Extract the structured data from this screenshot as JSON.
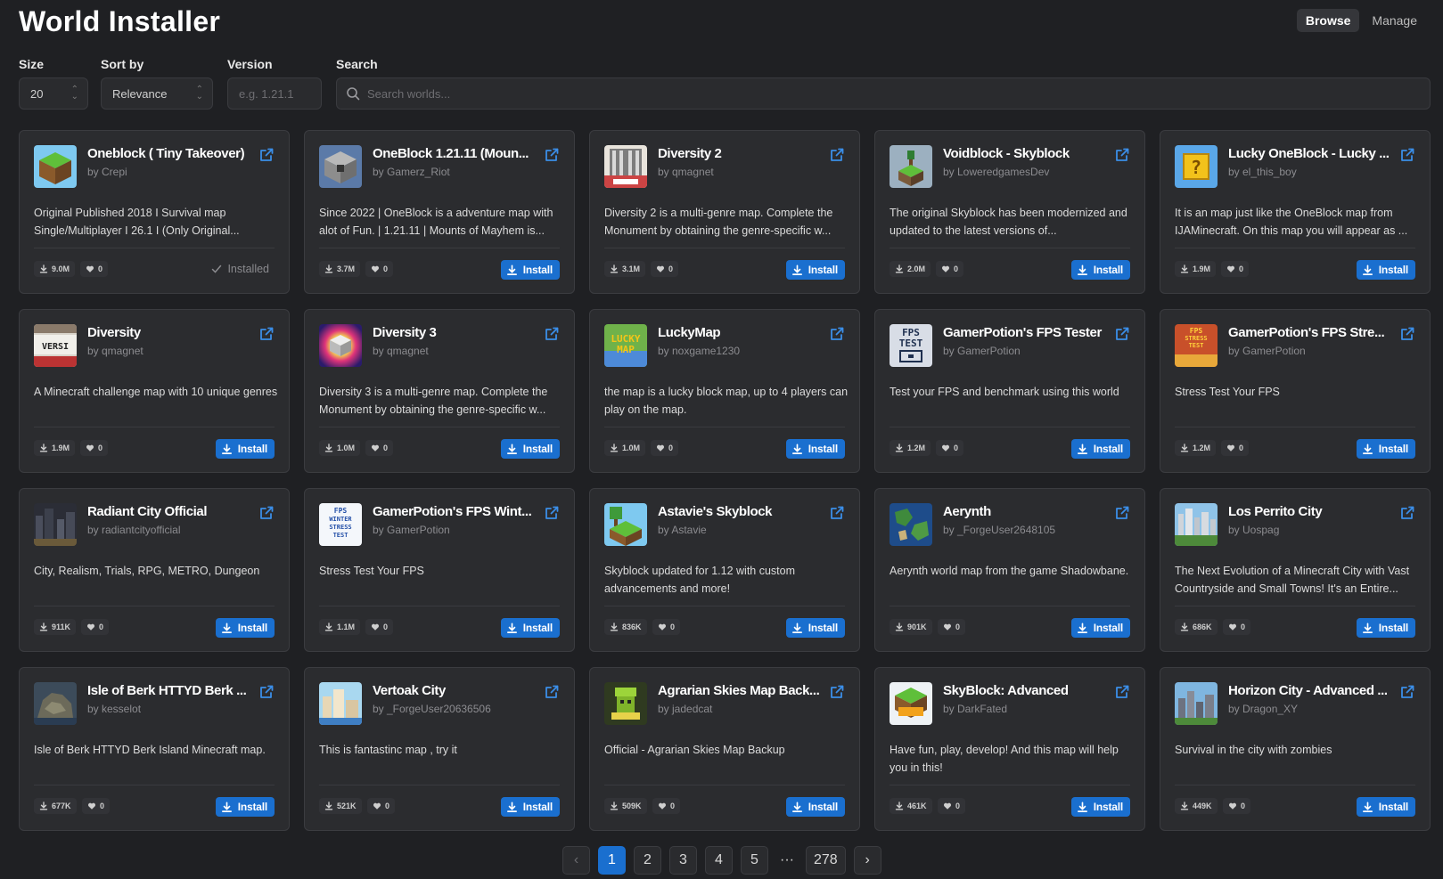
{
  "app": {
    "title": "World Installer"
  },
  "top_tabs": [
    {
      "label": "Browse",
      "active": true
    },
    {
      "label": "Manage",
      "active": false
    }
  ],
  "filters": {
    "size": {
      "label": "Size",
      "value": "20"
    },
    "sort": {
      "label": "Sort by",
      "value": "Relevance"
    },
    "version": {
      "label": "Version",
      "placeholder": "e.g. 1.21.1"
    },
    "search": {
      "label": "Search",
      "placeholder": "Search worlds..."
    }
  },
  "labels": {
    "install": "Install",
    "installed": "Installed"
  },
  "colors": {
    "accent": "#1a6fcf",
    "background": "#1f2023",
    "card": "#2b2c2f"
  },
  "worlds": [
    {
      "title": "Oneblock ( Tiny Takeover)",
      "author": "by Crepi",
      "description": "Original Published 2018 I Survival map Single/Multiplayer I 26.1 I (Only Original...",
      "downloads": "9.0M",
      "likes": "0",
      "installed": true,
      "thumb": "grass"
    },
    {
      "title": "OneBlock 1.21.11 (Moun...",
      "author": "by Gamerz_Riot",
      "description": "Since 2022 | OneBlock is a adventure map with alot of Fun. | 1.21.11 | Mounts of Mayhem is...",
      "downloads": "3.7M",
      "likes": "0",
      "installed": false,
      "thumb": "stone"
    },
    {
      "title": "Diversity 2",
      "author": "by qmagnet",
      "description": "Diversity 2 is a multi-genre map. Complete the Monument by obtaining the genre-specific w...",
      "downloads": "3.1M",
      "likes": "0",
      "installed": false,
      "thumb": "pillar"
    },
    {
      "title": "Voidblock - Skyblock",
      "author": "by LoweredgamesDev",
      "description": "The original Skyblock has been modernized and updated to the latest versions of...",
      "downloads": "2.0M",
      "likes": "0",
      "installed": false,
      "thumb": "void"
    },
    {
      "title": "Lucky OneBlock - Lucky ...",
      "author": "by el_this_boy",
      "description": "It is an map just like the OneBlock map from IJAMinecraft. On this map you will appear as ...",
      "downloads": "1.9M",
      "likes": "0",
      "installed": false,
      "thumb": "lucky"
    },
    {
      "title": "Diversity",
      "author": "by qmagnet",
      "description": "A Minecraft challenge map with 10 unique genres",
      "downloads": "1.9M",
      "likes": "0",
      "installed": false,
      "thumb": "diversity"
    },
    {
      "title": "Diversity 3",
      "author": "by qmagnet",
      "description": "Diversity 3 is a multi-genre map. Complete the Monument by obtaining the genre-specific w...",
      "downloads": "1.0M",
      "likes": "0",
      "installed": false,
      "thumb": "rainbow"
    },
    {
      "title": "LuckyMap",
      "author": "by noxgame1230",
      "description": "the map is a lucky block map, up to 4 players can play on the map.",
      "downloads": "1.0M",
      "likes": "0",
      "installed": false,
      "thumb": "luckymap"
    },
    {
      "title": "GamerPotion's FPS Tester",
      "author": "by GamerPotion",
      "description": "Test your FPS and benchmark using this world",
      "downloads": "1.2M",
      "likes": "0",
      "installed": false,
      "thumb": "fps"
    },
    {
      "title": "GamerPotion's FPS Stre...",
      "author": "by GamerPotion",
      "description": "Stress Test Your FPS",
      "downloads": "1.2M",
      "likes": "0",
      "installed": false,
      "thumb": "fpsstress"
    },
    {
      "title": "Radiant City Official",
      "author": "by radiantcityofficial",
      "description": "City, Realism, Trials, RPG, METRO, Dungeon",
      "downloads": "911K",
      "likes": "0",
      "installed": false,
      "thumb": "city"
    },
    {
      "title": "GamerPotion's FPS Wint...",
      "author": "by GamerPotion",
      "description": "Stress Test Your FPS",
      "downloads": "1.1M",
      "likes": "0",
      "installed": false,
      "thumb": "winter"
    },
    {
      "title": "Astavie's Skyblock",
      "author": "by Astavie",
      "description": "Skyblock updated for 1.12 with custom advancements and more!",
      "downloads": "836K",
      "likes": "0",
      "installed": false,
      "thumb": "skyblock"
    },
    {
      "title": "Aerynth",
      "author": "by _ForgeUser2648105",
      "description": "Aerynth world map from the game Shadowbane.",
      "downloads": "901K",
      "likes": "0",
      "installed": false,
      "thumb": "map"
    },
    {
      "title": "Los Perrito City",
      "author": "by Uospag",
      "description": "The Next Evolution of a Minecraft City with Vast Countryside and Small Towns! It's an Entire...",
      "downloads": "686K",
      "likes": "0",
      "installed": false,
      "thumb": "perrito"
    },
    {
      "title": "Isle of Berk HTTYD Berk ...",
      "author": "by kesselot",
      "description": "Isle of Berk HTTYD Berk Island Minecraft map.",
      "downloads": "677K",
      "likes": "0",
      "installed": false,
      "thumb": "berk"
    },
    {
      "title": "Vertoak City",
      "author": "by _ForgeUser20636506",
      "description": "This is fantastinc map , try it",
      "downloads": "521K",
      "likes": "0",
      "installed": false,
      "thumb": "vertoak"
    },
    {
      "title": "Agrarian Skies Map Back...",
      "author": "by jadedcat",
      "description": "Official - Agrarian Skies Map Backup",
      "downloads": "509K",
      "likes": "0",
      "installed": false,
      "thumb": "agrarian"
    },
    {
      "title": "SkyBlock: Advanced",
      "author": "by DarkFated",
      "description": "Have fun, play, develop! And this map will help you in this!",
      "downloads": "461K",
      "likes": "0",
      "installed": false,
      "thumb": "advanced"
    },
    {
      "title": "Horizon City - Advanced ...",
      "author": "by Dragon_XY",
      "description": "Survival in the city with zombies",
      "downloads": "449K",
      "likes": "0",
      "installed": false,
      "thumb": "horizon"
    }
  ],
  "thumb_text": {
    "diversity": "VERSI",
    "luckymap": "LUCKY MAP",
    "fps": "FPS TEST",
    "fpsstress": "FPS STRESS TEST",
    "winter": "FPS WINTER STRESS TEST"
  },
  "pagination": {
    "prev": "‹",
    "next": "›",
    "pages": [
      "1",
      "2",
      "3",
      "4",
      "5"
    ],
    "ellipsis": "···",
    "last": "278",
    "current": "1"
  }
}
